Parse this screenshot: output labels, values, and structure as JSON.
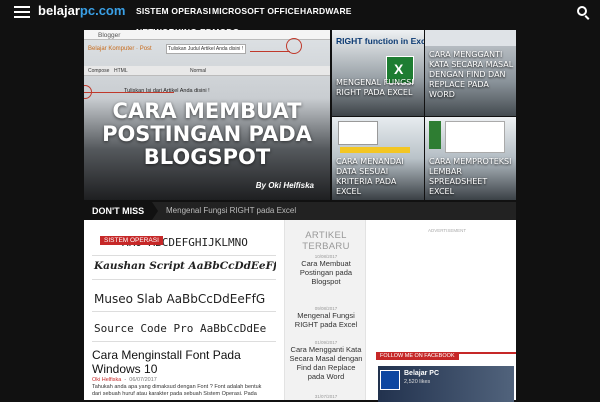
{
  "header": {
    "logo_main": "belajar",
    "logo_accent": "pc.com",
    "nav": [
      "SISTEM OPERASI",
      "MICROSOFT OFFICE",
      "HARDWARE",
      "NETWORKING",
      "EDMODO"
    ]
  },
  "slider": {
    "main": {
      "title": "CARA MEMBUAT POSTINGAN PADA BLOGSPOT",
      "author": "By Oki Helfiska",
      "editor_brand": "Blogger",
      "editor_crumb": "Belajar Komputer · Post",
      "editor_title_hint": "Tuliskan Judul Artikel Anda disini !",
      "editor_body_hint": "Tuliskan Isi dari Artikel Anda disini !",
      "editor_tabs": [
        "Compose",
        "HTML"
      ],
      "editor_format": "Normal"
    },
    "items": [
      {
        "caption": "MENGENAL FUNGSI RIGHT PADA EXCEL",
        "thumb_heading": "RIGHT function in Excel"
      },
      {
        "caption": "CARA MENGGANTI KATA SECARA MASAL DENGAN FIND DAN REPLACE PADA WORD"
      },
      {
        "caption": "CARA MENANDAI DATA SESUAI KRITERIA PADA EXCEL"
      },
      {
        "caption": "CARA MEMPROTEKSI LEMBAR SPREADSHEET EXCEL"
      }
    ]
  },
  "dont_miss": {
    "label": "DON'T MISS",
    "headline": "Mengenal Fungsi RIGHT pada Excel"
  },
  "post": {
    "badge": "SISTEM OPERASI",
    "font_samples": [
      "ARO ABCDEFGHIJKLMNO",
      "Kaushan Script AaBbCcDdEeFfGgHhIi",
      "Museo Slab AaBbCcDdEeFfG",
      "Source Code Pro AaBbCcDdEe"
    ],
    "title": "Cara Menginstall Font Pada Windows 10",
    "author": "Oki Helfiska",
    "date": "06/07/2017",
    "excerpt": "Tahukah anda apa yang dimaksud dengan Font ? Font adalah bentuk dari sebuah huruf atau karakter pada sebuah Sistem Operasi. Pada"
  },
  "sidebar": {
    "heading": "ARTIKEL TERBARU",
    "items": [
      {
        "date": "10/08/2017",
        "title": "Cara Membuat Postingan pada Blogspot"
      },
      {
        "date": "09/08/2017",
        "title": "Mengenal Fungsi RIGHT pada Excel"
      },
      {
        "date": "01/09/2017",
        "title": "Cara Mengganti Kata Secara Masal dengan Find dan Replace pada Word"
      },
      {
        "date": "31/07/2017",
        "title": ""
      }
    ]
  },
  "right": {
    "ad_label": "ADVERTISEMENT",
    "fb_label": "FOLLOW ME ON FACEBOOK",
    "fb_name": "Belajar PC",
    "fb_likes": "2,520 likes"
  },
  "colors": {
    "accent_red": "#c62828",
    "logo_blue": "#3aa0e6",
    "bar_dark": "#111111"
  }
}
